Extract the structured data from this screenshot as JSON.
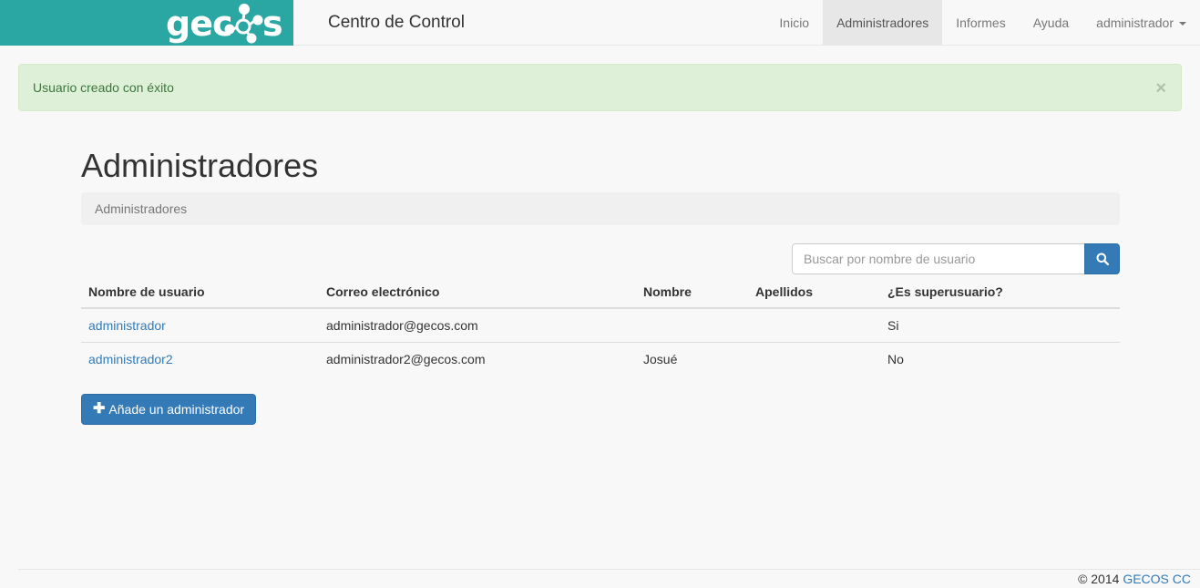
{
  "navbar": {
    "logo_text": "gecos",
    "title": "Centro de Control",
    "items": [
      {
        "label": "Inicio",
        "active": false
      },
      {
        "label": "Administradores",
        "active": true
      },
      {
        "label": "Informes",
        "active": false
      },
      {
        "label": "Ayuda",
        "active": false
      }
    ],
    "user_menu": {
      "label": "administrador",
      "icon": "caret-down-icon"
    }
  },
  "alert": {
    "text": "Usuario creado con éxito",
    "close_symbol": "×",
    "colors": {
      "background": "#dff0d8",
      "text": "#3c763d"
    }
  },
  "main": {
    "title": "Administradores",
    "breadcrumb": "Administradores",
    "search": {
      "placeholder": "Buscar por nombre de usuario",
      "value": "",
      "icon": "search-icon"
    },
    "table": {
      "headers": [
        "Nombre de usuario",
        "Correo electrónico",
        "Nombre",
        "Apellidos",
        "¿Es superusuario?"
      ],
      "rows": [
        {
          "username": "administrador",
          "email": "administrador@gecos.com",
          "name": "",
          "surname": "",
          "superuser": "Si"
        },
        {
          "username": "administrador2",
          "email": "administrador2@gecos.com",
          "name": "Josué",
          "surname": "",
          "superuser": "No"
        }
      ]
    },
    "add_button": {
      "label": "Añade un administrador",
      "icon": "plus-icon"
    }
  },
  "footer": {
    "copyright": "© 2014",
    "link": "GECOS CC"
  },
  "colors": {
    "brand": "#2ba7a3",
    "primary": "#337ab7",
    "link": "#337ab7"
  }
}
